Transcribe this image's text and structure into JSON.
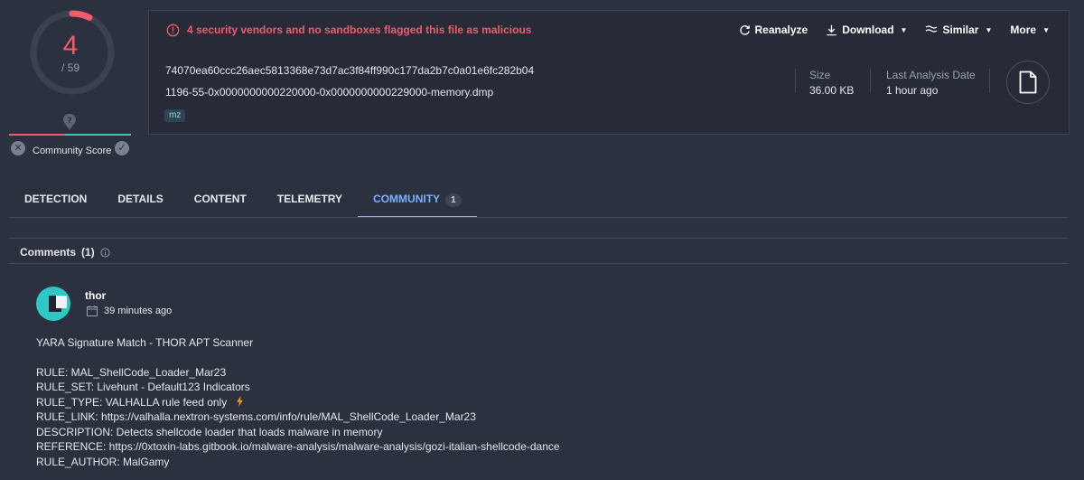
{
  "score": {
    "detected": "4",
    "total": "/ 59",
    "community_label": "Community Score",
    "colors": {
      "malicious": "#f25b6b",
      "harmless": "#3fc7a8"
    }
  },
  "header": {
    "alert_text": "4 security vendors and no sandboxes flagged this file as malicious",
    "actions": {
      "reanalyze": "Reanalyze",
      "download": "Download",
      "similar": "Similar",
      "more": "More"
    },
    "hash": "74070ea60ccc26aec5813368e73d7ac3f84ff990c177da2b7c0a01e6fc282b04",
    "filename": "1196-55-0x0000000000220000-0x0000000000229000-memory.dmp",
    "tag": "mz",
    "size_label": "Size",
    "size_value": "36.00 KB",
    "last_analysis_label": "Last Analysis Date",
    "last_analysis_value": "1 hour ago"
  },
  "tabs": {
    "detection": "DETECTION",
    "details": "DETAILS",
    "content": "CONTENT",
    "telemetry": "TELEMETRY",
    "community": "COMMUNITY",
    "community_count": "1"
  },
  "comments": {
    "title": "Comments",
    "count": "(1)",
    "author": "thor",
    "time": "39 minutes ago",
    "lines": {
      "l0": "YARA Signature Match - THOR APT Scanner",
      "l1": "RULE: MAL_ShellCode_Loader_Mar23",
      "l2": "RULE_SET: Livehunt - Default123 Indicators",
      "l3": "RULE_TYPE: VALHALLA rule feed only",
      "l4": "RULE_LINK: https://valhalla.nextron-systems.com/info/rule/MAL_ShellCode_Loader_Mar23",
      "l5": "DESCRIPTION: Detects shellcode loader that loads malware in memory",
      "l6": "REFERENCE: https://0xtoxin-labs.gitbook.io/malware-analysis/malware-analysis/gozi-italian-shellcode-dance",
      "l7": "RULE_AUTHOR: MalGamy"
    }
  }
}
